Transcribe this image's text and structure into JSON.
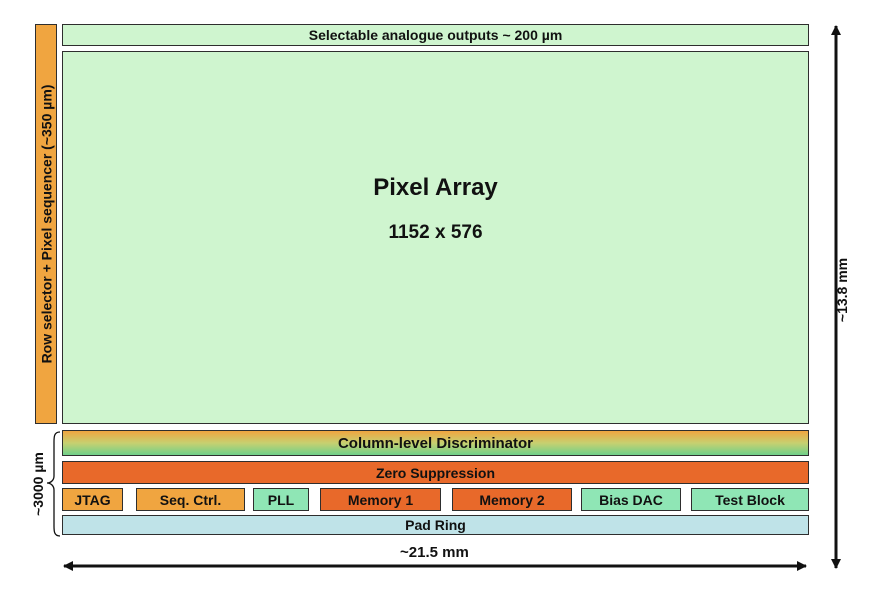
{
  "blocks": {
    "analogue_outputs": "Selectable analogue outputs ~ 200 µm",
    "row_selector": "Row selector + Pixel sequencer (~350 µm)",
    "pixel_array_title": "Pixel Array",
    "pixel_array_size": "1152 x 576",
    "column_discriminator": "Column-level Discriminator",
    "zero_suppression": "Zero Suppression",
    "jtag": "JTAG",
    "seq_ctrl": "Seq. Ctrl.",
    "pll": "PLL",
    "memory1": "Memory 1",
    "memory2": "Memory 2",
    "bias_dac": "Bias DAC",
    "test_block": "Test Block",
    "pad_ring": "Pad Ring"
  },
  "dimensions": {
    "width": "~21.5 mm",
    "height": "~13.8 mm",
    "bottom_section": "~3000 µm"
  },
  "colors": {
    "array_green": "#cff5cf",
    "light_orange": "#f0a540",
    "dark_orange": "#e8692a",
    "teal": "#8fe6b5",
    "pad_blue": "#bfe3e8"
  }
}
